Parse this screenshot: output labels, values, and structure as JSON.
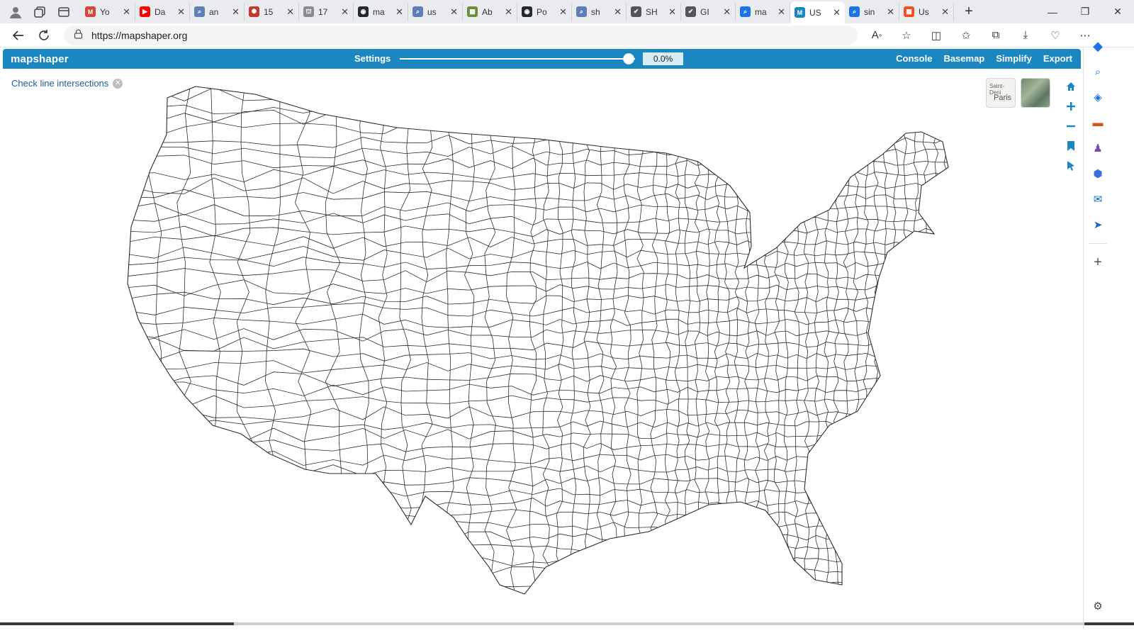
{
  "browser": {
    "tabs": [
      {
        "title": "Yo",
        "favicon_color": "#d44638",
        "favicon_glyph": "M"
      },
      {
        "title": "Da",
        "favicon_color": "#ff0000",
        "favicon_glyph": "▶"
      },
      {
        "title": "an",
        "favicon_color": "#5f7fb8",
        "favicon_glyph": "⌕"
      },
      {
        "title": "15",
        "favicon_color": "#c0392b",
        "favicon_glyph": "✺"
      },
      {
        "title": "17",
        "favicon_color": "#8a8a8a",
        "favicon_glyph": "⛫"
      },
      {
        "title": "ma",
        "favicon_color": "#24292e",
        "favicon_glyph": "◉"
      },
      {
        "title": "us",
        "favicon_color": "#5f7fb8",
        "favicon_glyph": "⌕"
      },
      {
        "title": "Ab",
        "favicon_color": "#6b8e3a",
        "favicon_glyph": "▦"
      },
      {
        "title": "Po",
        "favicon_color": "#24292e",
        "favicon_glyph": "◉"
      },
      {
        "title": "sh",
        "favicon_color": "#5f7fb8",
        "favicon_glyph": "⌕"
      },
      {
        "title": "SH",
        "favicon_color": "#555555",
        "favicon_glyph": "✔"
      },
      {
        "title": "GI",
        "favicon_color": "#555555",
        "favicon_glyph": "✔"
      },
      {
        "title": "ma",
        "favicon_color": "#1a73e8",
        "favicon_glyph": "⌕"
      },
      {
        "title": "US",
        "favicon_color": "#1a87c1",
        "favicon_glyph": "M",
        "active": true
      },
      {
        "title": "sin",
        "favicon_color": "#1a73e8",
        "favicon_glyph": "⌕"
      },
      {
        "title": "Us",
        "favicon_color": "#f25022",
        "favicon_glyph": "▦"
      }
    ],
    "url": "https://mapshaper.org"
  },
  "app": {
    "logo": "mapshaper",
    "settings_label": "Settings",
    "simplify_percent": "0.0%",
    "simplify_level": 1.0,
    "menu": [
      "Console",
      "Basemap",
      "Simplify",
      "Export"
    ],
    "intersections_label": "Check line intersections",
    "basemap_thumb_labels": [
      "Saint-Deni",
      "Paris"
    ],
    "accent_color": "#1a87c1"
  }
}
